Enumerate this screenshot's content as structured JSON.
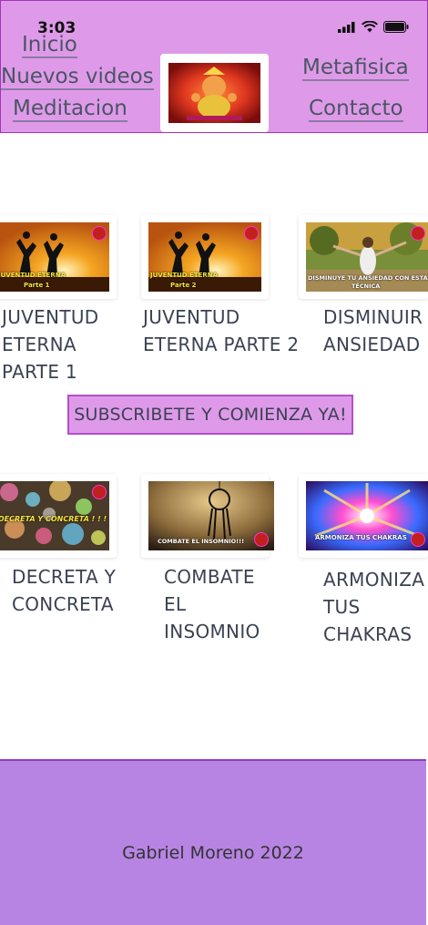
{
  "status_bar": {
    "time": "3:03"
  },
  "nav": {
    "inicio": "Inicio",
    "nuevos_videos": "Nuevos videos",
    "meditacion": "Meditacion",
    "metafisica": "Metafisica",
    "contacto": "Contacto"
  },
  "videos": [
    {
      "title_lines": [
        "JUVENTUD",
        "ETERNA",
        "PARTE 1"
      ],
      "thumb_caption": "JUVENTUD ETERNA",
      "thumb_caption2": "Parte 1"
    },
    {
      "title_lines": [
        "JUVENTUD",
        "ETERNA PARTE 2"
      ],
      "thumb_caption": "JUVENTUD ETERNA",
      "thumb_caption2": "Parte 2"
    },
    {
      "title_lines": [
        "DISMINUIR",
        "ANSIEDAD"
      ],
      "thumb_caption": "DISMINUYE TU ANSIEDAD CON ESTA",
      "thumb_caption2": "TÉCNICA"
    },
    {
      "title_lines": [
        "DECRETA Y",
        "CONCRETA"
      ],
      "thumb_caption": "DECRETA Y CONCRETA ! ! !"
    },
    {
      "title_lines": [
        "COMBATE",
        "EL",
        "INSOMNIO"
      ],
      "thumb_caption": "COMBATE EL INSOMNIO!!!"
    },
    {
      "title_lines": [
        "ARMONIZA",
        "TUS",
        "CHAKRAS"
      ],
      "thumb_caption": "ARMONIZA TUS CHAKRAS"
    }
  ],
  "subscribe_label": "SUBSCRIBETE Y COMIENZA YA!",
  "footer_text": "Gabriel Moreno 2022",
  "colors": {
    "header_bg": "#de9ae9",
    "footer_bg": "#b784e3",
    "accent_border": "#a531b8"
  }
}
